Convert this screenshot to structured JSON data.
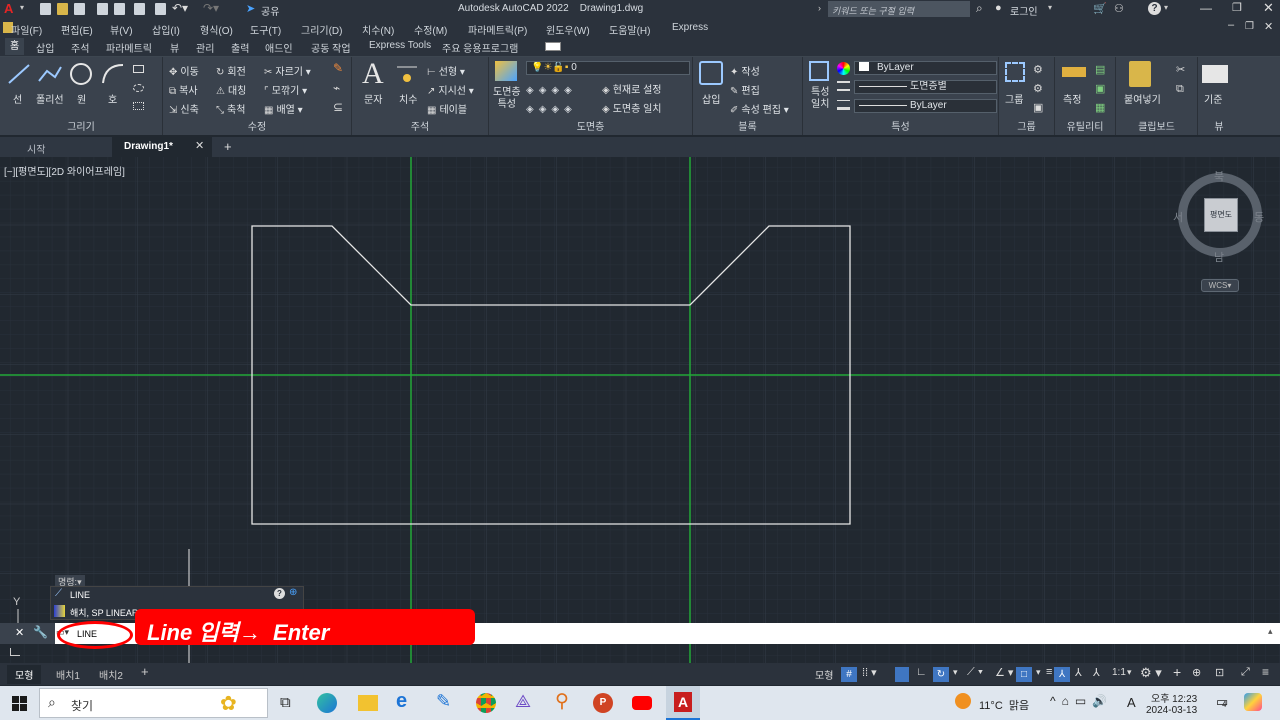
{
  "app": {
    "title": "Autodesk AutoCAD 2022",
    "file": "Drawing1.dwg",
    "share_label": "공유",
    "search_placeholder": "키워드 또는 구절 입력",
    "login_label": "로그인"
  },
  "menu": [
    "파일(F)",
    "편집(E)",
    "뷰(V)",
    "삽입(I)",
    "형식(O)",
    "도구(T)",
    "그리기(D)",
    "치수(N)",
    "수정(M)",
    "파라메트릭(P)",
    "윈도우(W)",
    "도움말(H)",
    "Express"
  ],
  "ribbon_tabs": [
    "홈",
    "삽입",
    "주석",
    "파라메트릭",
    "뷰",
    "관리",
    "출력",
    "애드인",
    "공동 작업",
    "Express Tools",
    "주요 응용프로그램"
  ],
  "ribbon": {
    "draw": {
      "label": "그리기",
      "line": "선",
      "polyline": "폴리선",
      "circle": "원",
      "arc": "호"
    },
    "modify": {
      "label": "수정",
      "move": "이동",
      "rotate": "회전",
      "trim": "자르기",
      "copy": "복사",
      "mirror": "대칭",
      "fillet": "모깎기",
      "stretch": "신축",
      "scale": "축척",
      "array": "배열"
    },
    "annotation": {
      "label": "주석",
      "text": "문자",
      "dimension": "치수",
      "linear": "선형",
      "leader": "지시선",
      "table": "테이블"
    },
    "layers": {
      "label": "도면층",
      "props": "도면층\n특성",
      "current_layer": "0",
      "make_current": "현재로 설정",
      "match": "도면층 일치"
    },
    "block": {
      "label": "블록",
      "insert": "삽입",
      "create": "작성",
      "edit": "편집",
      "attr_edit": "속성 편집"
    },
    "properties": {
      "label": "특성",
      "match": "특성\n일치",
      "color": "ByLayer",
      "linetype": "도면층별",
      "lineweight": "ByLayer"
    },
    "groups": {
      "label": "그룹",
      "group": "그룹"
    },
    "utilities": {
      "label": "유틸리티",
      "measure": "측정"
    },
    "clipboard": {
      "label": "클립보드",
      "paste": "붙여넣기"
    },
    "view": {
      "label": "뷰",
      "base": "기준"
    }
  },
  "file_tabs": {
    "start": "시작",
    "drawing": "Drawing1*",
    "add": "+"
  },
  "viewport": {
    "label": "[−][평면도][2D 와이어프레임]"
  },
  "viewcube": {
    "north": "북",
    "south": "남",
    "east": "동",
    "west": "서",
    "face": "평면도",
    "wcs": "WCS"
  },
  "command": {
    "history_label": "명령:",
    "suggest_1": "LINE",
    "suggest_2": "해치, SP LINEAR",
    "input": "LINE",
    "annotation": "Line 입력→  Enter"
  },
  "layout_tabs": [
    "모형",
    "배치1",
    "배치2"
  ],
  "status": {
    "model": "모형",
    "scale": "1:1"
  },
  "taskbar": {
    "search": "찾기",
    "weather": "11°C  맑음",
    "time": "오후 12:23",
    "date": "2024-03-13",
    "lang": "A",
    "notif": "4"
  },
  "colors": {
    "canvas": "#212830",
    "grid_axis": "#22a838",
    "shape": "#e6e6e6",
    "annotation": "#ff0000"
  }
}
